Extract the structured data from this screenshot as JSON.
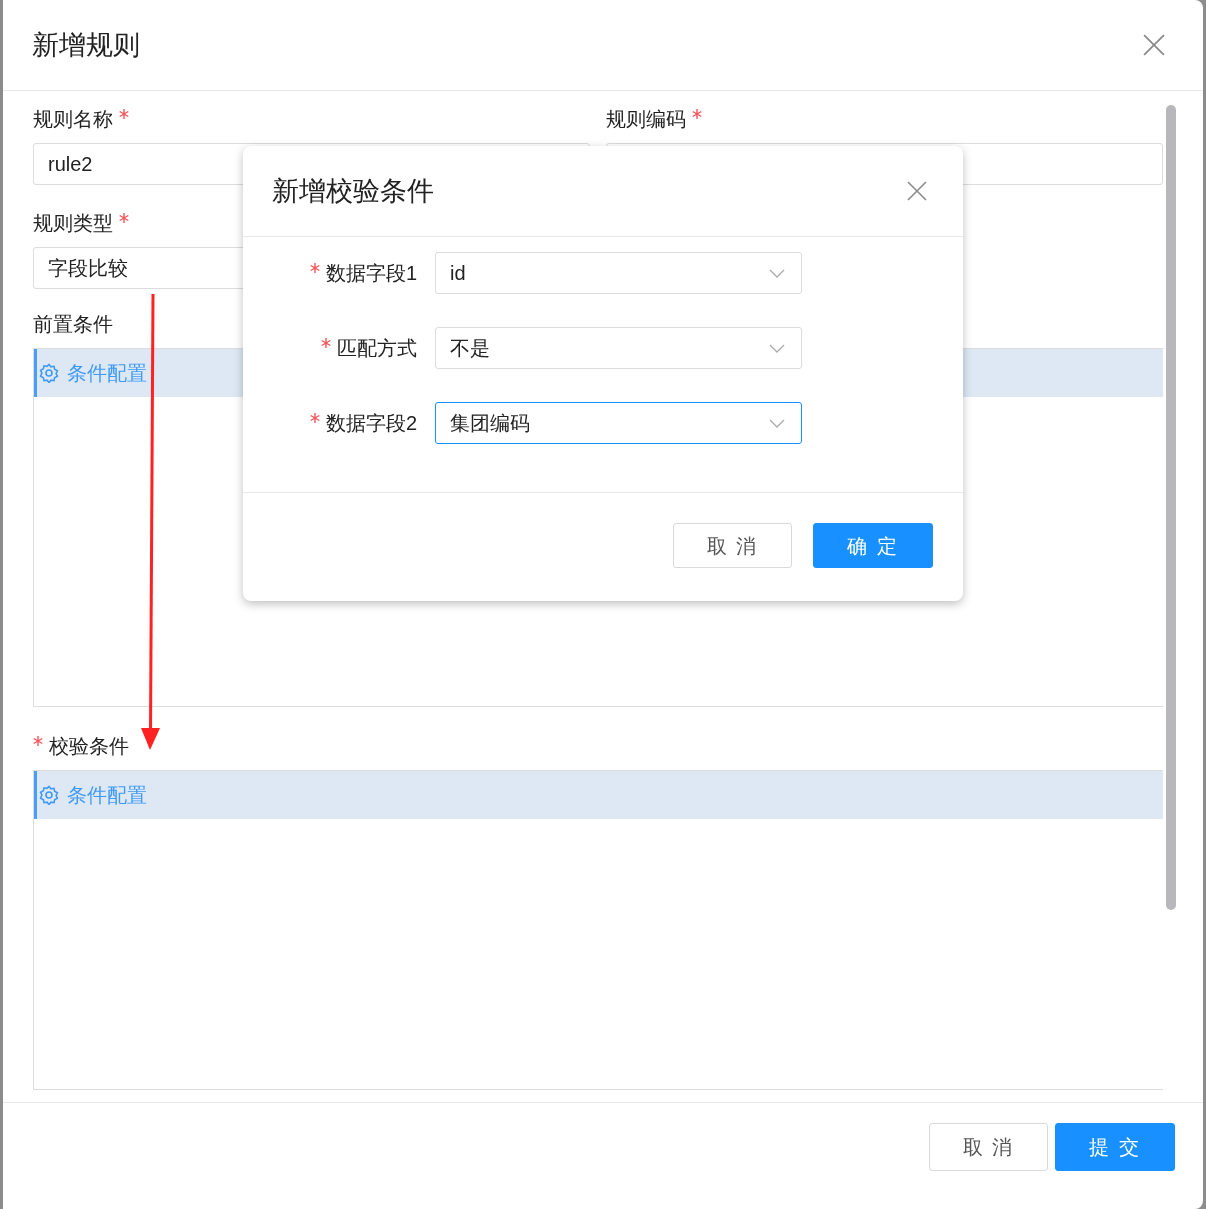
{
  "dialog": {
    "title": "新增规则",
    "fields": [
      {
        "label": "规则名称",
        "required": true,
        "value": "rule2"
      },
      {
        "label": "规则编码",
        "required": true
      },
      {
        "label": "规则类型",
        "required": true,
        "value": "字段比较"
      }
    ],
    "sections": [
      {
        "label": "前置条件",
        "required": false,
        "link": "条件配置"
      },
      {
        "label": "校验条件",
        "required": true,
        "link": "条件配置"
      }
    ],
    "buttons": [
      {
        "label": "取 消",
        "kind": "default"
      },
      {
        "label": "提 交",
        "kind": "primary"
      }
    ]
  },
  "inner_dialog": {
    "title": "新增校验条件",
    "fields": [
      {
        "label": "数据字段1",
        "required": true,
        "value": "id",
        "focused": false
      },
      {
        "label": "匹配方式",
        "required": true,
        "value": "不是",
        "focused": false
      },
      {
        "label": "数据字段2",
        "required": true,
        "value": "集团编码",
        "focused": true
      }
    ],
    "buttons": [
      {
        "label": "取 消",
        "kind": "default"
      },
      {
        "label": "确 定",
        "kind": "primary"
      }
    ]
  }
}
